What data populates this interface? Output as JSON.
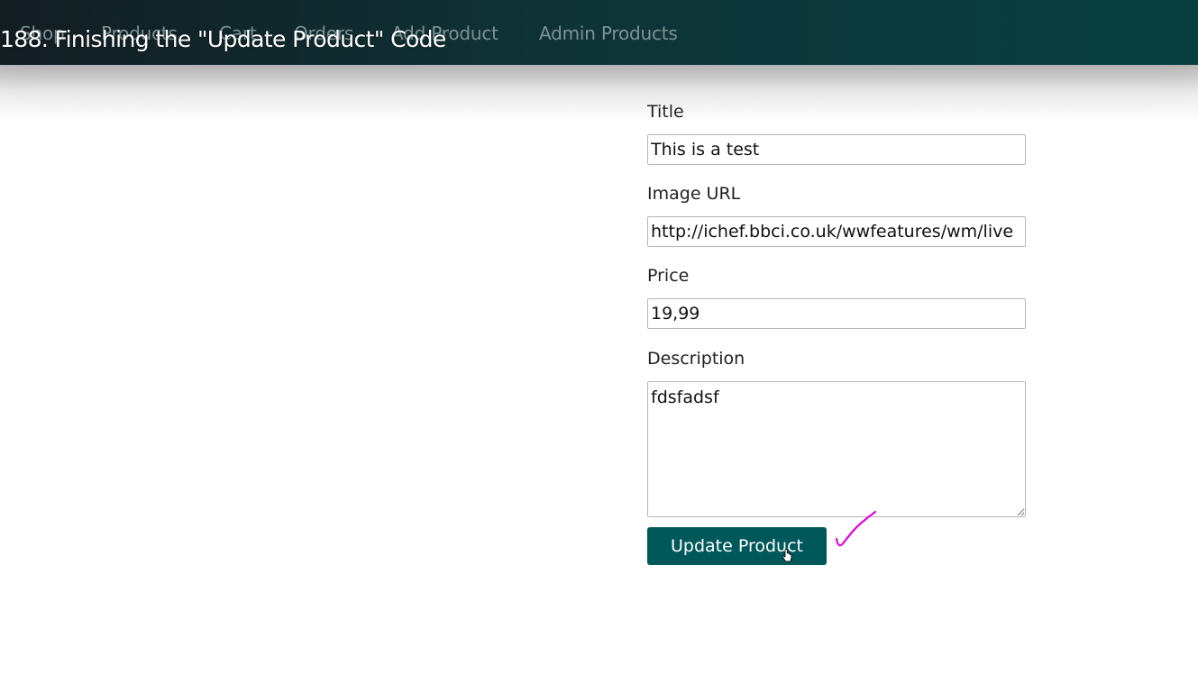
{
  "video_title": "188. Finishing the \"Update Product\" Code",
  "nav": {
    "items": [
      {
        "label": "Shop"
      },
      {
        "label": "Products"
      },
      {
        "label": "Cart"
      },
      {
        "label": "Orders"
      },
      {
        "label": "Add Product"
      },
      {
        "label": "Admin Products"
      }
    ]
  },
  "form": {
    "title_label": "Title",
    "title_value": "This is a test",
    "image_url_label": "Image URL",
    "image_url_value": "http://ichef.bbci.co.uk/wwfeatures/wm/live",
    "price_label": "Price",
    "price_value": "19,99",
    "description_label": "Description",
    "description_value": "fdsfadsf",
    "submit_label": "Update Product"
  },
  "colors": {
    "header_start": "#121d22",
    "header_end": "#073f40",
    "button_bg": "#00585a",
    "nav_text": "#7d9294",
    "annotation": "#e000e0"
  },
  "icons": {
    "cursor": "hand-pointer-icon",
    "annotation": "checkmark-icon"
  }
}
